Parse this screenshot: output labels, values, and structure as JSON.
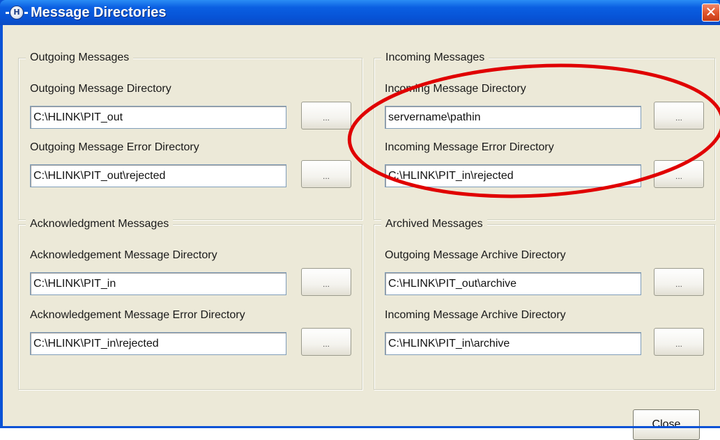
{
  "window": {
    "title": "Message Directories",
    "close_glyph": "✕",
    "app_icon": "app-logo-icon",
    "app_icon_letter": "H",
    "accent_color": "#0A52D6",
    "face_color": "#ECE9D8",
    "annotation_color": "#E00000"
  },
  "groups": {
    "outgoing": {
      "title": "Outgoing Messages",
      "dir_label": "Outgoing Message Directory",
      "dir_value": "C:\\HLINK\\PIT_out",
      "err_label": "Outgoing Message Error Directory",
      "err_value": "C:\\HLINK\\PIT_out\\rejected"
    },
    "incoming": {
      "title": "Incoming Messages",
      "dir_label": "Incoming Message Directory",
      "dir_value": "servername\\pathin",
      "err_label": "Incoming Message Error Directory",
      "err_value": "C:\\HLINK\\PIT_in\\rejected"
    },
    "ack": {
      "title": "Acknowledgment Messages",
      "dir_label": "Acknowledgement Message Directory",
      "dir_value": "C:\\HLINK\\PIT_in",
      "err_label": "Acknowledgement Message Error Directory",
      "err_value": "C:\\HLINK\\PIT_in\\rejected"
    },
    "archived": {
      "title": "Archived Messages",
      "out_label": "Outgoing Message Archive Directory",
      "out_value": "C:\\HLINK\\PIT_out\\archive",
      "in_label": "Incoming Message Archive Directory",
      "in_value": "C:\\HLINK\\PIT_in\\archive"
    }
  },
  "browse_label": "...",
  "close_button_label": "Close"
}
